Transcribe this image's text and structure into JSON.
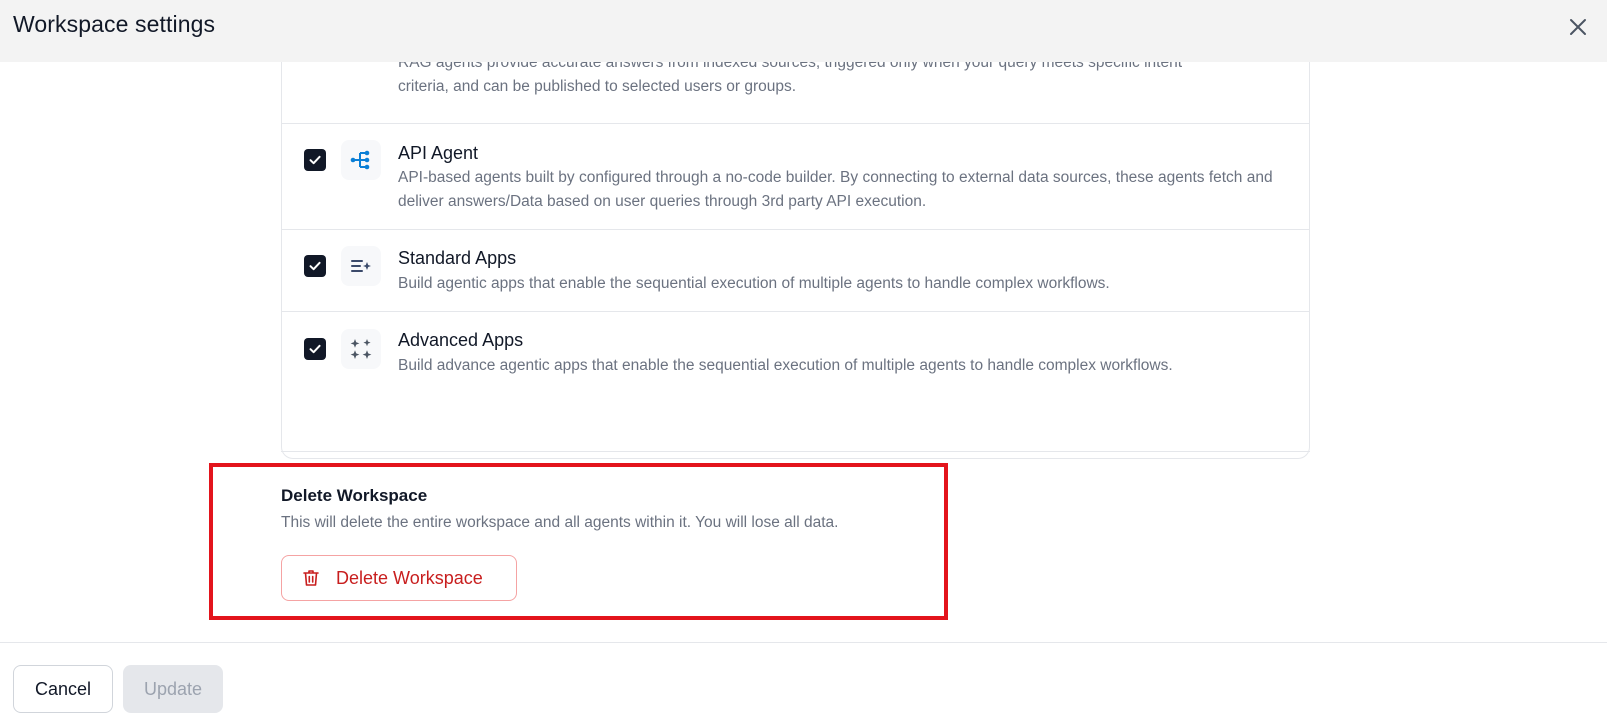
{
  "header": {
    "title": "Workspace settings",
    "close_icon": "close-icon"
  },
  "agents": {
    "partial": {
      "desc_line1": "RAG agents provide accurate answers from indexed sources, triggered only when your query meets specific intent",
      "desc_line2": "criteria, and can be published to selected users or groups."
    },
    "items": [
      {
        "name": "API Agent",
        "description": "API-based agents built by configured through a no-code builder. By connecting to external data sources, these agents fetch and deliver answers/Data based on user queries through 3rd party API execution.",
        "checked": true,
        "icon": "api-flow-icon",
        "icon_color": "#0b7fd6"
      },
      {
        "name": "Standard Apps",
        "description": "Build agentic apps that enable the sequential execution of multiple agents to handle complex workflows.",
        "checked": true,
        "icon": "list-sparkle-icon",
        "icon_color": "#3b4a6b"
      },
      {
        "name": "Advanced Apps",
        "description": "Build advance agentic apps that enable the sequential execution of multiple agents to handle complex workflows.",
        "checked": true,
        "icon": "sparkles-icon",
        "icon_color": "#4b5563"
      }
    ]
  },
  "delete_section": {
    "title": "Delete Workspace",
    "description": "This will delete the entire workspace and all agents within it. You will lose all data.",
    "button_label": "Delete Workspace",
    "button_icon": "trash-icon",
    "danger_color": "#c81e1e",
    "highlight_color": "#e3141c"
  },
  "footer": {
    "cancel_label": "Cancel",
    "update_label": "Update",
    "update_disabled": true
  }
}
